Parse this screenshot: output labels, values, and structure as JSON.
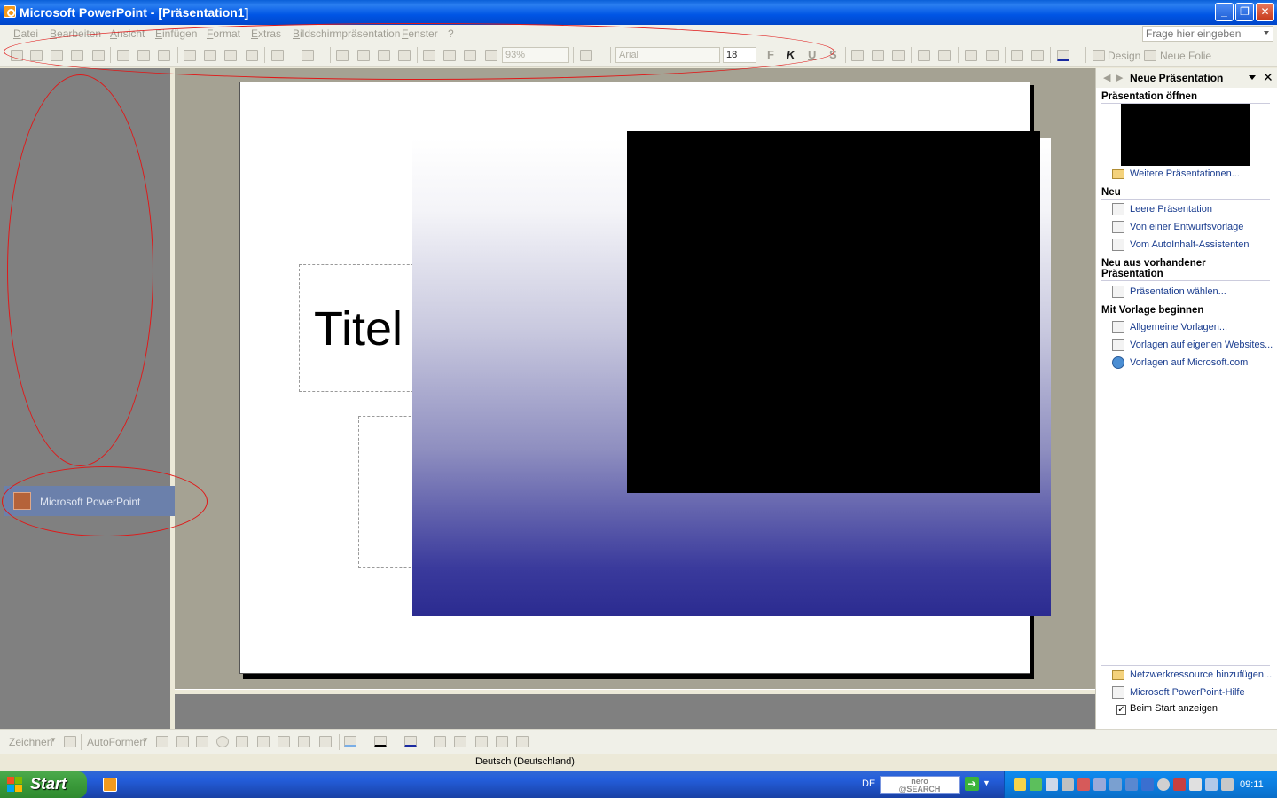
{
  "window": {
    "title": "Microsoft PowerPoint - [Präsentation1]",
    "controls": {
      "minimize": "_",
      "restore": "❐",
      "close": "✕"
    }
  },
  "menubar": {
    "items": [
      "Datei",
      "Bearbeiten",
      "Ansicht",
      "Einfügen",
      "Format",
      "Extras",
      "Bildschirmpräsentation",
      "Fenster",
      "?"
    ],
    "help_placeholder": "Frage hier eingeben"
  },
  "toolbar": {
    "zoom": "93%",
    "font": "Arial",
    "font_size": "18",
    "bold": "F",
    "italic": "K",
    "underline": "U",
    "shadow": "S",
    "design_label": "Design",
    "new_slide_label": "Neue Folie"
  },
  "left_pane": {
    "taskbutton_label": "Microsoft PowerPoint"
  },
  "slide": {
    "title_text": "Titel"
  },
  "taskpane": {
    "title": "Neue Präsentation",
    "sections": {
      "open": "Präsentation öffnen",
      "new": "Neu",
      "from_existing": "Neu aus vorhandener Präsentation",
      "templates": "Mit Vorlage beginnen"
    },
    "links": {
      "more": "Weitere Präsentationen...",
      "blank": "Leere Präsentation",
      "design_template": "Von einer Entwurfsvorlage",
      "autocontent": "Vom AutoInhalt-Assistenten",
      "choose_presentation": "Präsentation wählen...",
      "general_templates": "Allgemeine Vorlagen...",
      "website_templates": "Vorlagen auf eigenen Websites...",
      "microsoft_templates": "Vorlagen auf Microsoft.com",
      "network": "Netzwerkressource hinzufügen...",
      "help": "Microsoft PowerPoint-Hilfe"
    },
    "show_at_startup_label": "Beim Start anzeigen",
    "show_at_startup_checked": true
  },
  "drawbar": {
    "draw_label": "Zeichnen",
    "autoshapes_label": "AutoFormen"
  },
  "statusbar": {
    "language": "Deutsch (Deutschland)"
  },
  "taskbar": {
    "start_label": "Start",
    "lang": "DE",
    "nero_line1": "nero",
    "nero_line2": "@SEARCH",
    "clock": "09:11"
  },
  "colors": {
    "annotation": "#e01818",
    "taskbar": "#245edb",
    "start": "#3a9a3a",
    "link": "#1a3d8f"
  }
}
